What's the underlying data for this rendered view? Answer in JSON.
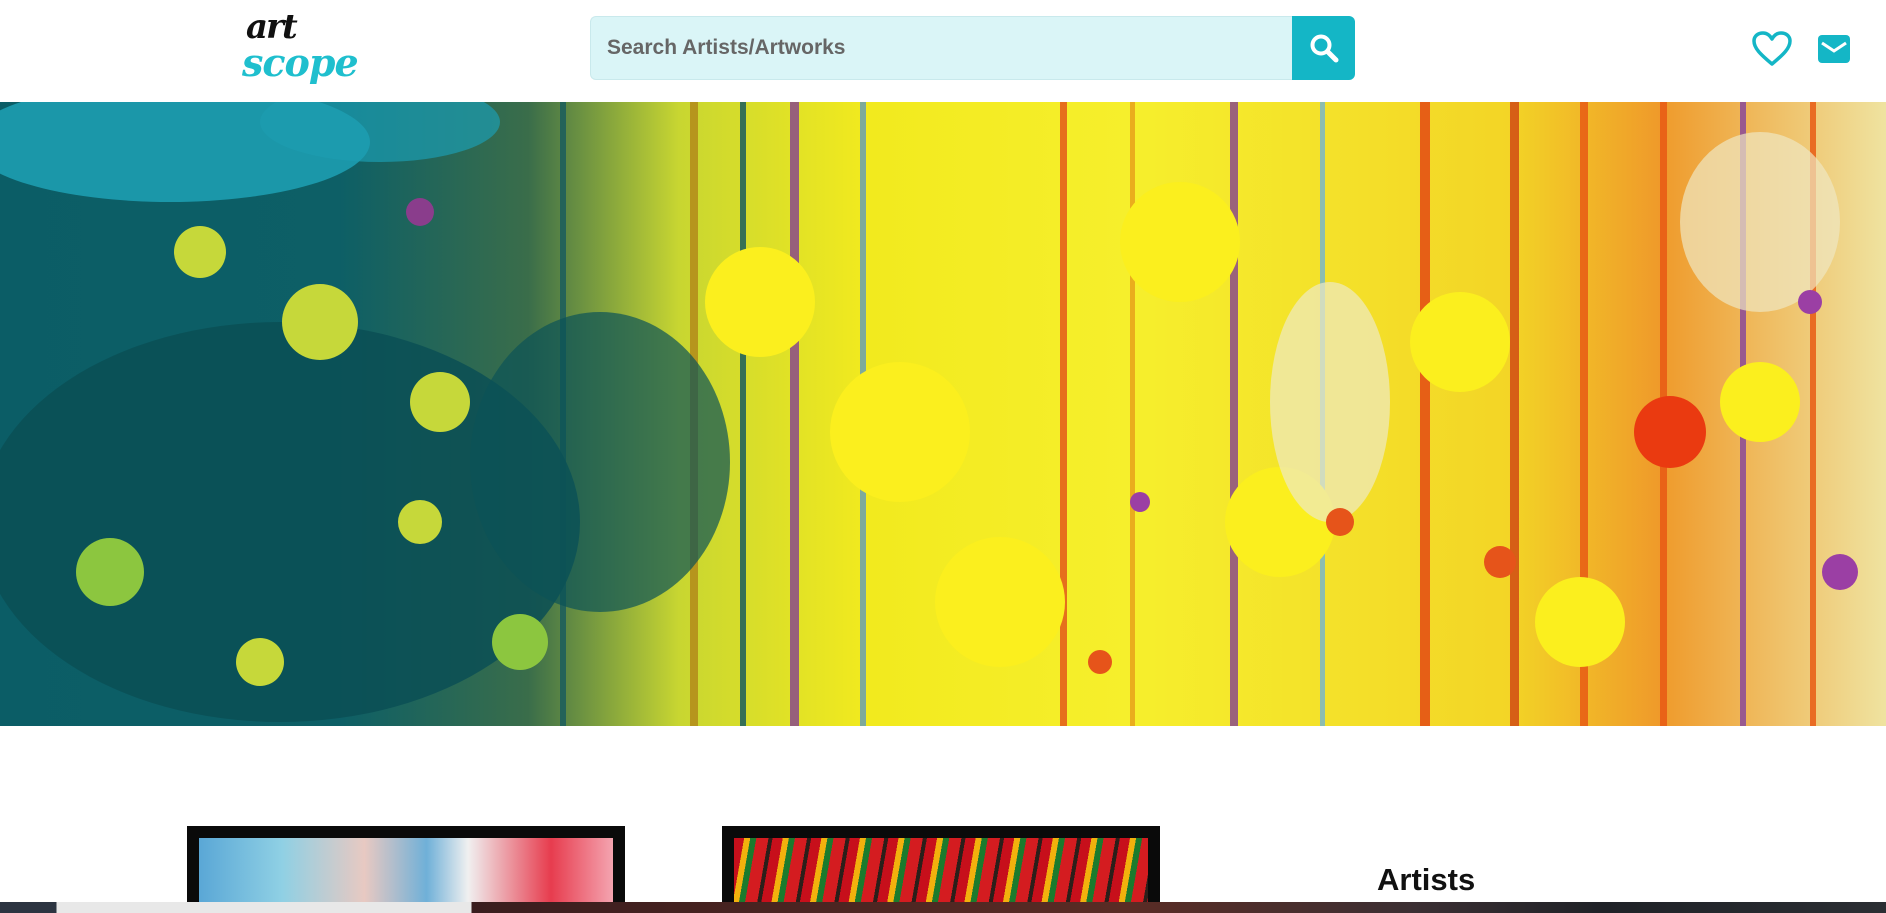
{
  "header": {
    "logo_line1": "art",
    "logo_line2": "scope"
  },
  "search": {
    "placeholder": "Search Artists/Artworks",
    "button_icon": "search-icon"
  },
  "icons": {
    "favorites": "heart-icon",
    "messages": "mail-icon"
  },
  "hero": {
    "image_description_icon": "abstract-paint-splatter-banner"
  },
  "cards": [
    {
      "icon": "artwork-thumbnail"
    },
    {
      "icon": "artwork-thumbnail"
    }
  ],
  "sidebar": {
    "artists_title": "Artists"
  },
  "colors": {
    "accent": "#14b6c6",
    "search_bg": "#daf5f7",
    "logo_teal": "#1fbfce"
  }
}
